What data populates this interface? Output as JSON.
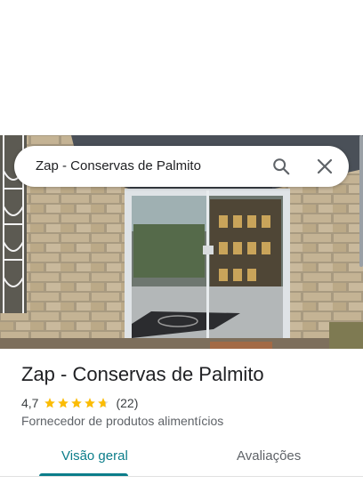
{
  "search": {
    "query": "Zap - Conservas de Palmito",
    "search_icon": "search-icon",
    "close_icon": "close-icon"
  },
  "place": {
    "name": "Zap - Conservas de Palmito",
    "rating": "4,7",
    "rating_value": 4.7,
    "review_count": "(22)",
    "category": "Fornecedor de produtos alimentícios"
  },
  "tabs": [
    {
      "label": "Visão geral",
      "active": true
    },
    {
      "label": "Avaliações",
      "active": false
    }
  ],
  "colors": {
    "accent": "#0b7d8a",
    "star": "#fbbc04",
    "star_empty": "#dadce0"
  }
}
